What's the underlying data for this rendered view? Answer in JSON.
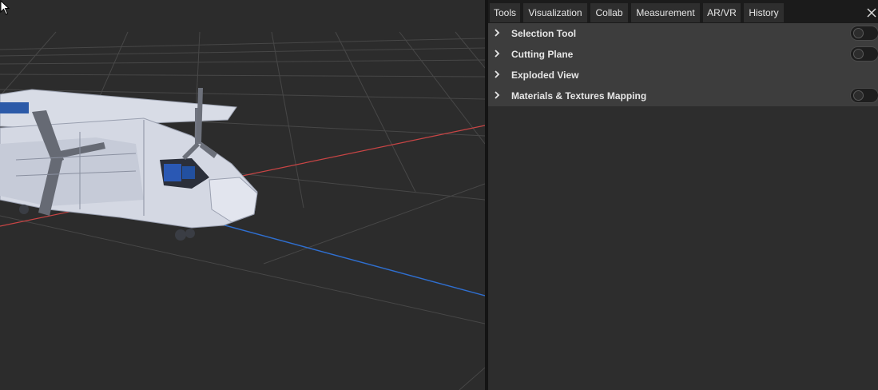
{
  "tabs": [
    {
      "label": "Tools",
      "active": true
    },
    {
      "label": "Visualization",
      "active": false
    },
    {
      "label": "Collab",
      "active": false
    },
    {
      "label": "Measurement",
      "active": false
    },
    {
      "label": "AR/VR",
      "active": false
    },
    {
      "label": "History",
      "active": false
    }
  ],
  "close_icon": "close-icon",
  "tools": {
    "items": [
      {
        "label": "Selection Tool",
        "has_toggle": true,
        "enabled": false
      },
      {
        "label": "Cutting Plane",
        "has_toggle": true,
        "enabled": false
      },
      {
        "label": "Exploded View",
        "has_toggle": false
      },
      {
        "label": "Materials & Textures Mapping",
        "has_toggle": true,
        "enabled": false
      }
    ]
  },
  "viewport": {
    "background": "#2c2c2c",
    "grid_color": "#4a4a4a",
    "x_axis_color": "#d24848",
    "z_axis_color": "#2a6fd6",
    "model_icon": "helicopter-model"
  }
}
